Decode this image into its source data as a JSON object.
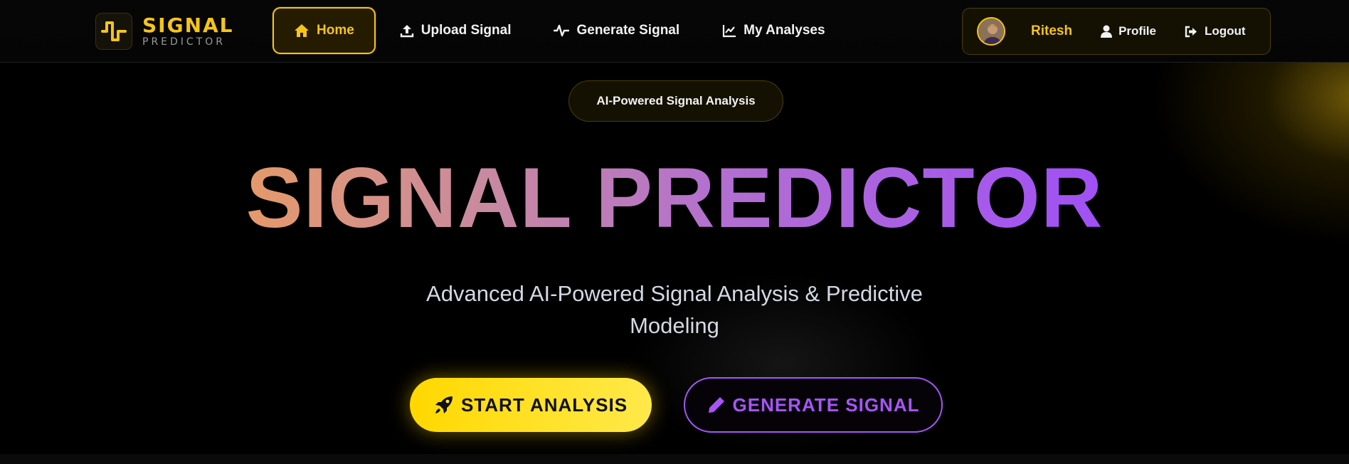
{
  "app": {
    "logo_line1": "SIGNAL",
    "logo_line2": "PREDICTOR"
  },
  "nav": {
    "items": [
      {
        "label": "Home",
        "icon": "home-icon",
        "active": true
      },
      {
        "label": "Upload Signal",
        "icon": "upload-icon"
      },
      {
        "label": "Generate Signal",
        "icon": "signal-wave-icon"
      },
      {
        "label": "My Analyses",
        "icon": "line-chart-icon"
      }
    ]
  },
  "user": {
    "name": "Ritesh",
    "profile_label": "Profile",
    "logout_label": "Logout"
  },
  "hero": {
    "badge": "AI-Powered Signal Analysis",
    "title": "SIGNAL PREDICTOR",
    "subtitle_line1": "Advanced AI-Powered Signal Analysis & Predictive",
    "subtitle_line2": "Modeling",
    "start_button": "START ANALYSIS",
    "generate_button": "GENERATE SIGNAL"
  },
  "colors": {
    "accent_yellow": "#f5c518",
    "accent_purple": "#a855f7",
    "background": "#000000"
  }
}
